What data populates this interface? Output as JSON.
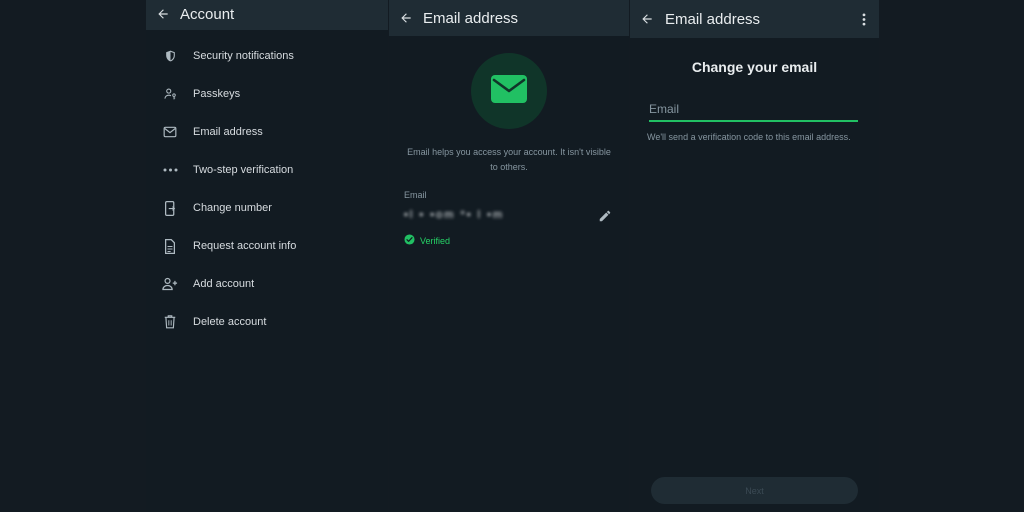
{
  "account_panel": {
    "title": "Account",
    "items": [
      {
        "label": "Security notifications",
        "icon": "shield-icon"
      },
      {
        "label": "Passkeys",
        "icon": "passkey-icon"
      },
      {
        "label": "Email address",
        "icon": "mail-icon"
      },
      {
        "label": "Two-step verification",
        "icon": "dots-icon"
      },
      {
        "label": "Change number",
        "icon": "phone-transfer-icon"
      },
      {
        "label": "Request account info",
        "icon": "document-icon"
      },
      {
        "label": "Add account",
        "icon": "add-person-icon"
      },
      {
        "label": "Delete account",
        "icon": "trash-icon"
      }
    ]
  },
  "email_panel": {
    "title": "Email address",
    "description": "Email helps you access your account. It isn't visible to others.",
    "email_label": "Email",
    "email_value": "•l  • •om *• l •m",
    "verified_label": "Verified"
  },
  "change_panel": {
    "title": "Email address",
    "heading": "Change your email",
    "input_placeholder": "Email",
    "description": "We'll send a verification code to this email address.",
    "next_label": "Next"
  },
  "colors": {
    "background": "#131b22",
    "appbar": "#1f2c34",
    "accent": "#25d366",
    "muted_text": "#8696a0"
  }
}
